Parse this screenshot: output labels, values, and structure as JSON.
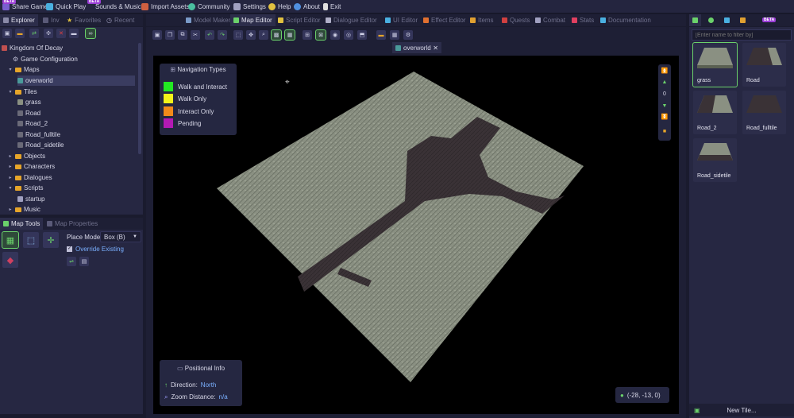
{
  "menu": {
    "items": [
      "Share Game",
      "Quick Play",
      "Sounds & Music",
      "Import Assets",
      "Community",
      "Settings",
      "Help",
      "About",
      "Exit"
    ],
    "beta_label": "BETA"
  },
  "left_tabs": {
    "explorer": "Explorer",
    "inventory": "Inv",
    "favorites": "Favorites",
    "recent": "Recent"
  },
  "editor_tabs": [
    "Model Maker",
    "Map Editor",
    "Script Editor",
    "Dialogue Editor",
    "UI Editor",
    "Effect Editor",
    "Items",
    "Quests",
    "Combat",
    "Stats",
    "Documentation"
  ],
  "explorer": {
    "project": "Kingdom Of Decay",
    "items": [
      {
        "label": "Game Configuration"
      },
      {
        "label": "Maps"
      },
      {
        "label": "overworld"
      },
      {
        "label": "Tiles"
      },
      {
        "label": "grass"
      },
      {
        "label": "Road"
      },
      {
        "label": "Road_2"
      },
      {
        "label": "Road_fulltile"
      },
      {
        "label": "Road_sidetile"
      },
      {
        "label": "Objects"
      },
      {
        "label": "Characters"
      },
      {
        "label": "Dialogues"
      },
      {
        "label": "Scripts"
      },
      {
        "label": "startup"
      },
      {
        "label": "Music"
      }
    ]
  },
  "map_tools": {
    "tab_tools": "Map Tools",
    "tab_props": "Map Properties",
    "place_mode_label": "Place Mode:",
    "place_mode_value": "Box (B)",
    "override_label": "Override Existing",
    "override_checked": true
  },
  "document_tab": "overworld",
  "navigation": {
    "title": "Navigation Types",
    "types": [
      {
        "label": "Walk and Interact",
        "color": "#22e822"
      },
      {
        "label": "Walk Only",
        "color": "#f2f21a"
      },
      {
        "label": "Interact Only",
        "color": "#f28a1a"
      },
      {
        "label": "Pending",
        "color": "#b41ab4"
      }
    ]
  },
  "positional": {
    "title": "Positional Info",
    "direction_label": "Direction:",
    "direction_value": "North",
    "zoom_label": "Zoom Distance:",
    "zoom_value": "n/a"
  },
  "coords": "(-28, -13, 0)",
  "layer_value": "0",
  "tiles_panel": {
    "filter_placeholder": "[Enter name to filter by]",
    "tiles": [
      "grass",
      "Road",
      "Road_2",
      "Road_fulltile",
      "Road_sidetile"
    ],
    "new_tile_label": "New Tile..."
  },
  "colors": {
    "accent": "#6bd16b",
    "bg": "#1a1b2e",
    "panel": "#262742",
    "grass": "#8a9082",
    "road": "#3a3236"
  }
}
